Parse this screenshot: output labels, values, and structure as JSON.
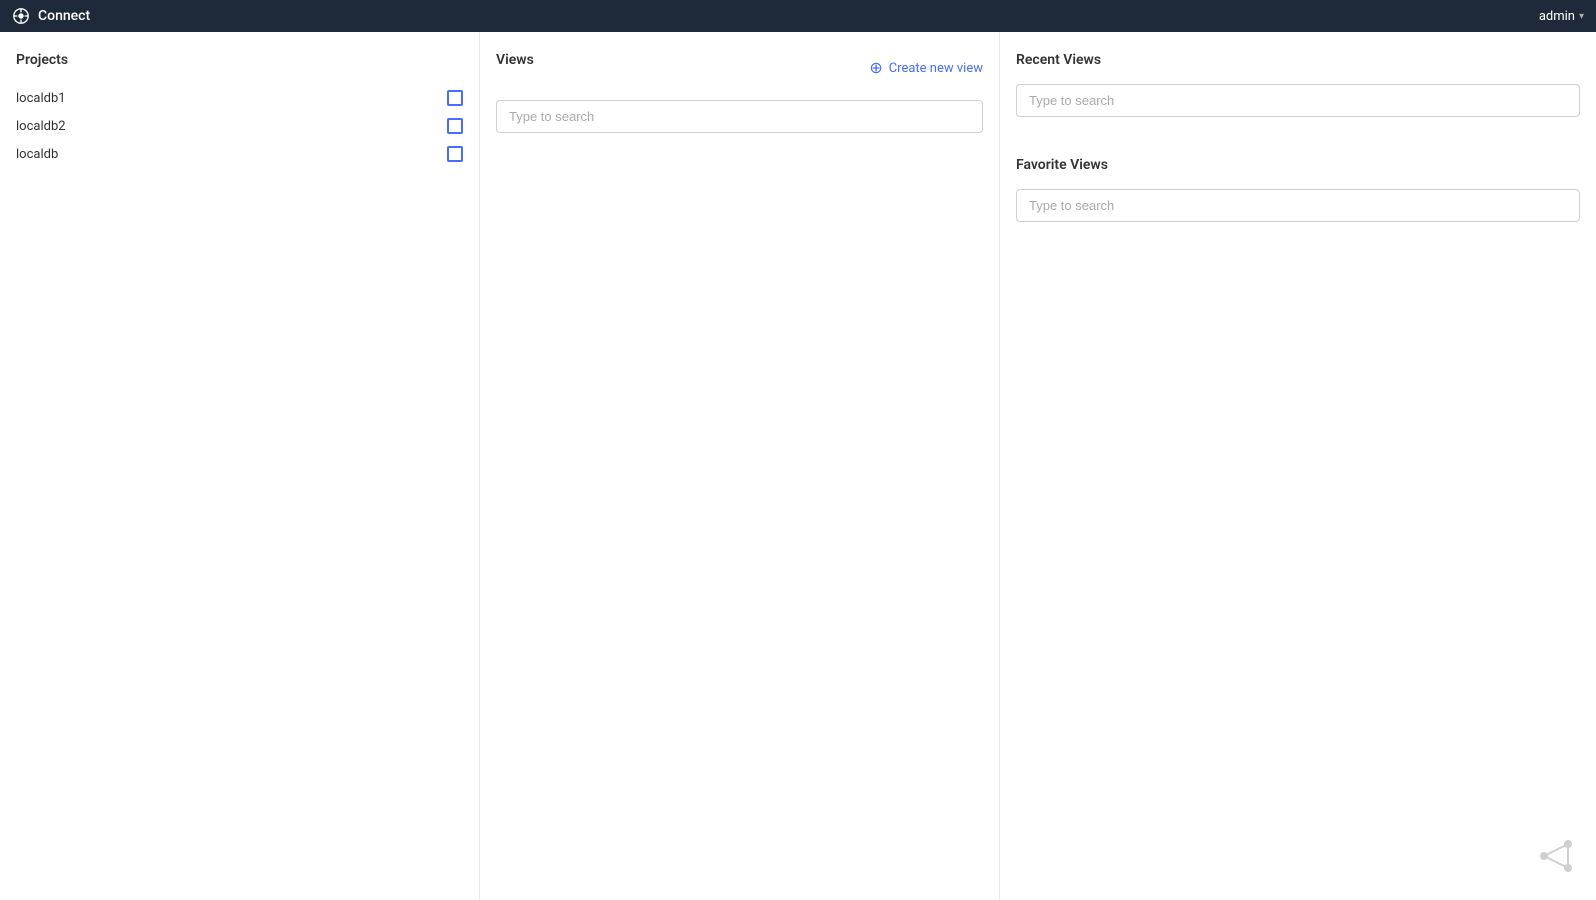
{
  "app": {
    "title": "Connect",
    "user": "admin"
  },
  "topbar": {
    "title": "Connect",
    "user_label": "admin",
    "chevron": "▾"
  },
  "projects": {
    "title": "Projects",
    "items": [
      {
        "name": "localdb1"
      },
      {
        "name": "localdb2"
      },
      {
        "name": "localdb"
      }
    ]
  },
  "views": {
    "title": "Views",
    "search_placeholder": "Type to search",
    "create_new_label": "Create new view"
  },
  "recent_views": {
    "title": "Recent Views",
    "search_placeholder": "Type to search"
  },
  "favorite_views": {
    "title": "Favorite Views",
    "search_placeholder": "Type to search"
  }
}
